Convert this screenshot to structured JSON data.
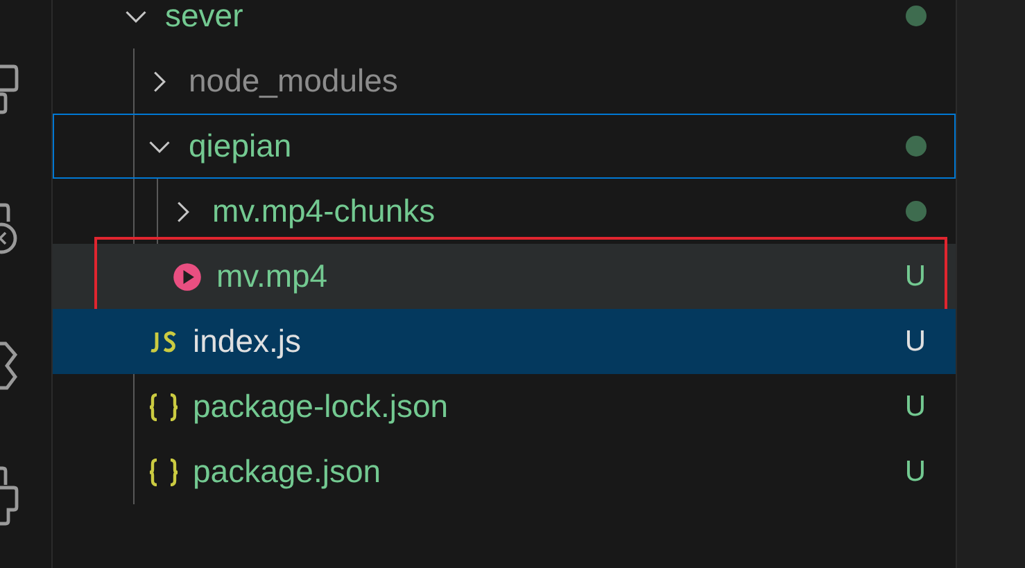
{
  "tree": [
    {
      "name": "sever",
      "kind": "folder",
      "expanded": true,
      "has_changes": true,
      "children": [
        {
          "name": "node_modules",
          "kind": "folder",
          "expanded": false,
          "ignored": true,
          "has_changes": false
        },
        {
          "name": "qiepian",
          "kind": "folder",
          "expanded": true,
          "focused": true,
          "has_changes": true,
          "children": [
            {
              "name": "mv.mp4-chunks",
              "kind": "folder",
              "expanded": false,
              "has_changes": true
            },
            {
              "name": "mv.mp4",
              "kind": "video",
              "status": "U",
              "hovered": true,
              "highlighted": true
            }
          ]
        },
        {
          "name": "index.js",
          "kind": "js",
          "status": "U",
          "selected": true
        },
        {
          "name": "package-lock.json",
          "kind": "json",
          "status": "U",
          "selected": false
        },
        {
          "name": "package.json",
          "kind": "json",
          "status": "U",
          "selected": false
        }
      ]
    }
  ]
}
